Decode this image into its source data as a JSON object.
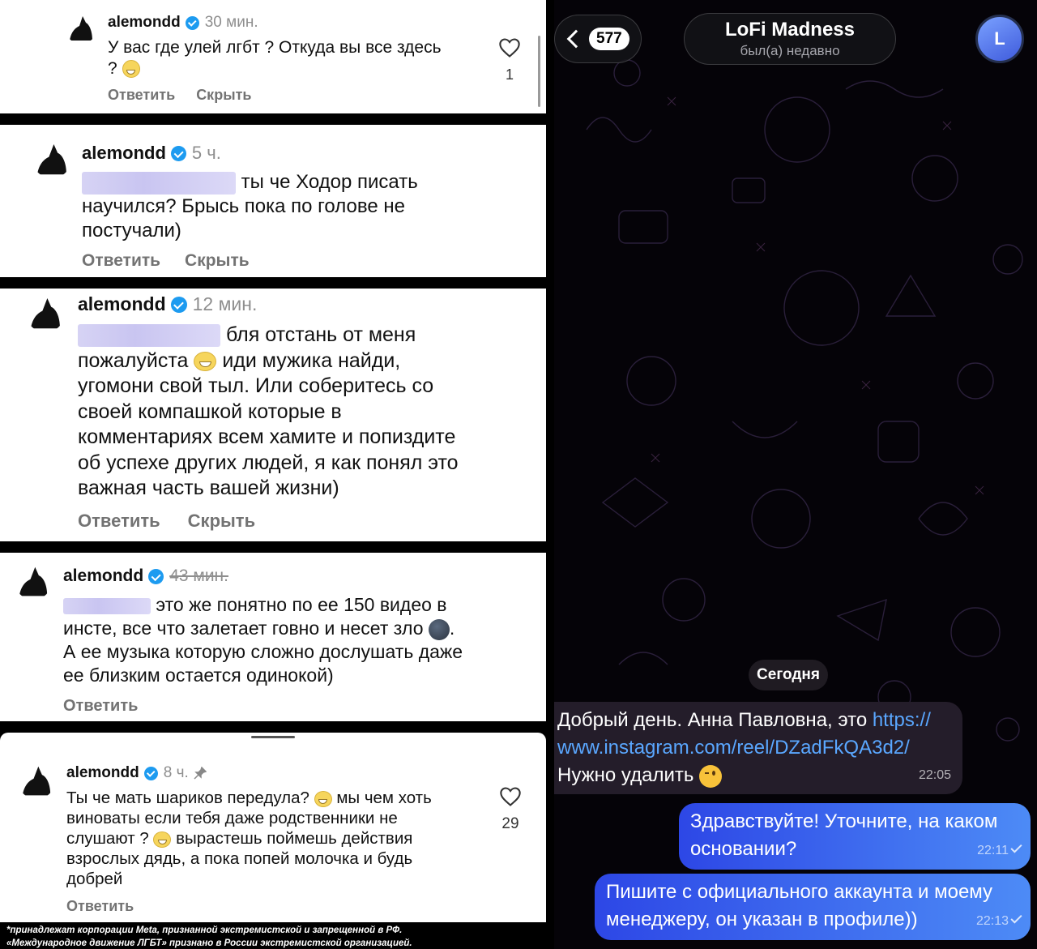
{
  "comments": [
    {
      "username": "alemondd",
      "time": "30 мин.",
      "text_line1": "У вас где улей лгбт ? Откуда вы все здесь",
      "text_line2": "?",
      "reply": "Ответить",
      "hide": "Скрыть",
      "likes": "1"
    },
    {
      "username": "alemondd",
      "time": "5 ч.",
      "text_line1": "ты че Ходор писать",
      "text_rest": "научился? Брысь пока по голове не поступчали)",
      "text_line2": "научился? Брысь пока по голове не",
      "text_line3": "постучали)",
      "reply": "Ответить",
      "hide": "Скрыть"
    },
    {
      "username": "alemondd",
      "time": "12 мин.",
      "text_line1": "бля отстань от меня",
      "text_line2a": "пожалуйста",
      "text_line2b": "иди мужика найди,",
      "text_line3": "угомони свой тыл. Или соберитесь со",
      "text_line4": "своей компашкой которые в",
      "text_line5": "комментариях всем хамите и попиздите",
      "text_line6": "об успехе других людей, я как понял это",
      "text_line7": "важная часть вашей жизни)",
      "reply": "Ответить",
      "hide": "Скрыть"
    },
    {
      "username": "alemondd",
      "time": "43 мин.",
      "text_line1": "это же понятно по ее 150 видео в",
      "text_line2": "инсте, все что залетает говно и несет зло",
      "text_line3": "А ее музыка которую сложно дослушать даже",
      "text_line4": "ее близким остается одинокой)",
      "reply": "Ответить"
    },
    {
      "username": "alemondd",
      "time": "8 ч.",
      "text_line1a": "Ты че мать шариков передула?",
      "text_line1b": "мы чем хоть",
      "text_line2": "виноваты если тебя даже родственники не",
      "text_line3a": "слушают ?",
      "text_line3b": "вырастешь поймешь действия",
      "text_line4": "взрослых дядь, а пока попей молочка и будь",
      "text_line5": "добрей",
      "reply": "Ответить",
      "likes": "29"
    }
  ],
  "disclaimer": {
    "line1": "*принадлежат корпорации Meta, признанной экстремистской и запрещенной в РФ.",
    "line2": "«Международное движение ЛГБТ» признано в России экстремистской организацией."
  },
  "telegram": {
    "back_count": "577",
    "chat_title": "LoFi Madness",
    "chat_status": "был(а) недавно",
    "avatar_letter": "L",
    "date_divider": "Сегодня",
    "messages": [
      {
        "direction": "incoming",
        "text_prefix": "Добрый день. Анна Павловна, это ",
        "link_part1": "https://",
        "link_part2": "www.instagram.com/reel/DZadFkQA3d2/",
        "text_suffix": "Нужно удалить",
        "time": "22:05"
      },
      {
        "direction": "outgoing",
        "line1": "Здравствуйте! Уточните, на каком",
        "line2": "основании?",
        "time": "22:11"
      },
      {
        "direction": "outgoing",
        "line1": "Пишите с официального аккаунта и моему",
        "line2": "менеджеру, он указан в профиле))",
        "time": "22:13"
      }
    ],
    "colors": {
      "outgoing_start": "#2d47e6",
      "outgoing_end": "#4d8bf6",
      "link": "#5aa7ff",
      "incoming_bg": "#241d2a"
    }
  }
}
